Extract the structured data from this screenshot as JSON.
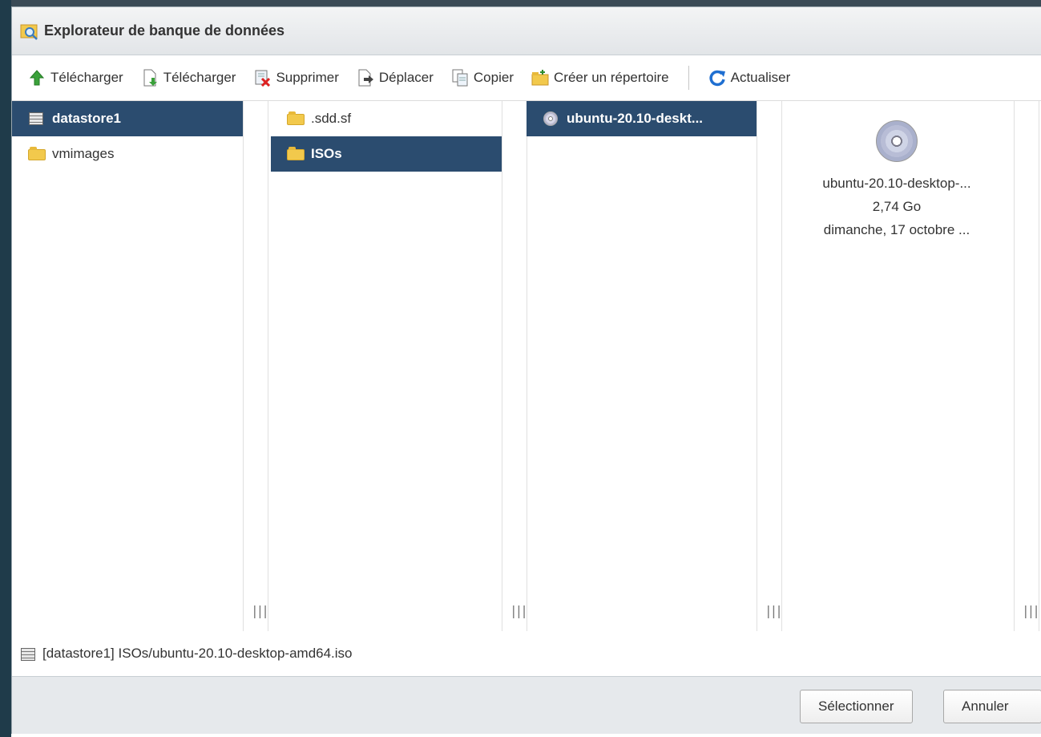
{
  "dialog": {
    "title": "Explorateur de banque de données"
  },
  "toolbar": {
    "upload": "Télécharger",
    "download": "Télécharger",
    "delete": "Supprimer",
    "move": "Déplacer",
    "copy": "Copier",
    "mkdir": "Créer un répertoire",
    "refresh": "Actualiser"
  },
  "columns": {
    "col1": [
      {
        "label": "datastore1",
        "selected": true,
        "icon": "datastore-icon"
      },
      {
        "label": "vmimages",
        "selected": false,
        "icon": "folder-icon"
      }
    ],
    "col2": [
      {
        "label": ".sdd.sf",
        "selected": false,
        "icon": "folder-icon"
      },
      {
        "label": "ISOs",
        "selected": true,
        "icon": "folder-icon"
      }
    ],
    "col3": [
      {
        "label": "ubuntu-20.10-deskt...",
        "selected": true,
        "icon": "disc-icon"
      }
    ]
  },
  "preview": {
    "name": "ubuntu-20.10-desktop-...",
    "size": "2,74 Go",
    "date": "dimanche, 17 octobre ...",
    "icon": "disc-icon"
  },
  "resize_handle": "|||",
  "path": {
    "text": "[datastore1] ISOs/ubuntu-20.10-desktop-amd64.iso"
  },
  "buttons": {
    "select": "Sélectionner",
    "cancel": "Annuler"
  },
  "colors": {
    "selection": "#2b4c6f",
    "folder": "#f2c94c"
  }
}
